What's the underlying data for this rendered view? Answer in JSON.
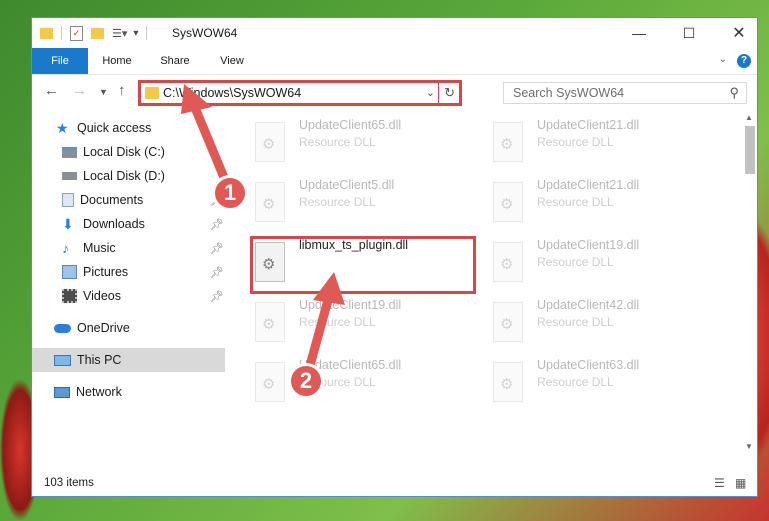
{
  "window": {
    "title": "SysWOW64",
    "controls": [
      "minimize-icon",
      "maximize-icon",
      "close-icon"
    ]
  },
  "ribbon": {
    "tabs": [
      "File",
      "Home",
      "Share",
      "View"
    ],
    "help": "?"
  },
  "address": {
    "path": "C:\\Windows\\SysWOW64",
    "search_placeholder": "Search SysWOW64"
  },
  "sidebar": {
    "items": [
      {
        "label": "Quick access",
        "icon": "star-icon"
      },
      {
        "label": "Local Disk (C:)",
        "icon": "drive-icon"
      },
      {
        "label": "Local Disk (D:)",
        "icon": "drive-icon"
      },
      {
        "label": "Documents",
        "icon": "documents-icon",
        "pinned": true
      },
      {
        "label": "Downloads",
        "icon": "download-icon",
        "pinned": true
      },
      {
        "label": "Music",
        "icon": "music-icon",
        "pinned": true
      },
      {
        "label": "Pictures",
        "icon": "pictures-icon",
        "pinned": true
      },
      {
        "label": "Videos",
        "icon": "videos-icon",
        "pinned": true
      },
      {
        "label": "OneDrive",
        "icon": "cloud-icon"
      },
      {
        "label": "This PC",
        "icon": "computer-icon",
        "selected": true
      },
      {
        "label": "Network",
        "icon": "network-icon"
      }
    ]
  },
  "files": {
    "left": [
      {
        "name": "UpdateClient65.dll",
        "type": "Resource DLL"
      },
      {
        "name": "UpdateClient5.dll",
        "type": "Resource DLL"
      },
      {
        "name": "libmux_ts_plugin.dll",
        "type": "",
        "selected": true
      },
      {
        "name": "UpdateClient19.dll",
        "type": "Resource DLL"
      },
      {
        "name": "UpdateClient65.dll",
        "type": "Resource DLL"
      }
    ],
    "right": [
      {
        "name": "UpdateClient21.dll",
        "type": "Resource DLL"
      },
      {
        "name": "UpdateClient21.dll",
        "type": "Resource DLL"
      },
      {
        "name": "UpdateClient19.dll",
        "type": "Resource DLL"
      },
      {
        "name": "UpdateClient42.dll",
        "type": "Resource DLL"
      },
      {
        "name": "UpdateClient63.dll",
        "type": "Resource DLL"
      }
    ]
  },
  "status": {
    "items": "103 items"
  },
  "annotations": {
    "step1": "1",
    "step2": "2",
    "color": "#e05a55"
  },
  "colors": {
    "accent": "#1979ca",
    "highlight": "#d64848"
  }
}
